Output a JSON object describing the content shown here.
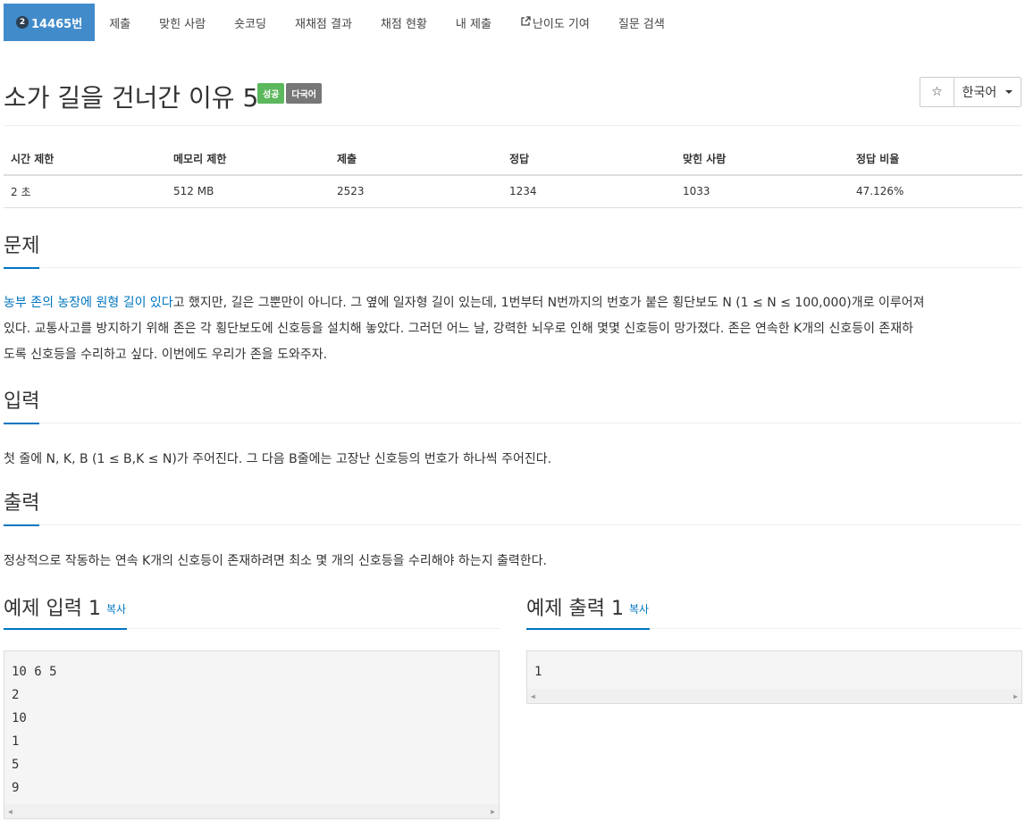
{
  "nav": {
    "problem_number": "14465번",
    "tier_badge": "2",
    "items": [
      "제출",
      "맞힌 사람",
      "숏코딩",
      "재채점 결과",
      "채점 현황",
      "내 제출",
      "난이도 기여",
      "질문 검색"
    ]
  },
  "header": {
    "title": "소가 길을 건너간 이유 5",
    "badge_success": "성공",
    "badge_language": "다국어",
    "star": "☆",
    "language": "한국어"
  },
  "stats": {
    "headers": [
      "시간 제한",
      "메모리 제한",
      "제출",
      "정답",
      "맞힌 사람",
      "정답 비율"
    ],
    "values": [
      "2 초",
      "512 MB",
      "2523",
      "1234",
      "1033",
      "47.126%"
    ]
  },
  "problem": {
    "heading": "문제",
    "link_text": "농부 존의 농장에 원형 길이 있다",
    "line1_rest": "고 했지만, 길은 그뿐만이 아니다. 그 옆에 일자형 길이 있는데, 1번부터 N번까지의 번호가 붙은 횡단보도 N (1 ≤ N ≤ 100,000)개로 이루어져",
    "line2": "있다. 교통사고를 방지하기 위해 존은 각 횡단보도에 신호등을 설치해 놓았다. 그러던 어느 날, 강력한 뇌우로 인해 몇몇 신호등이 망가졌다. 존은 연속한 K개의 신호등이 존재하",
    "line3": "도록 신호등을 수리하고 싶다. 이번에도 우리가 존을 도와주자."
  },
  "input": {
    "heading": "입력",
    "text": "첫 줄에 N, K, B (1 ≤ B,K ≤ N)가 주어진다. 그 다음 B줄에는 고장난 신호등의 번호가 하나씩 주어진다."
  },
  "output": {
    "heading": "출력",
    "text": "정상적으로 작동하는 연속 K개의 신호등이 존재하려면 최소 몇 개의 신호등을 수리해야 하는지 출력한다."
  },
  "sample_input": {
    "heading": "예제 입력 1",
    "copy": "복사",
    "lines": [
      "10 6 5",
      "2",
      "10",
      "1",
      "5",
      "9"
    ]
  },
  "sample_output": {
    "heading": "예제 출력 1",
    "copy": "복사",
    "lines": [
      "1"
    ]
  }
}
